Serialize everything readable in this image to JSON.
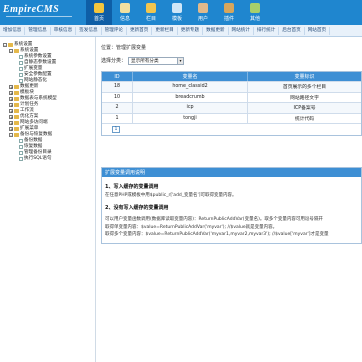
{
  "header": {
    "logo_text": "EmpireCMS",
    "tabs": [
      {
        "label": "首页",
        "icon": "home-icon",
        "color": "#f3c53d",
        "active": true
      },
      {
        "label": "信息",
        "icon": "info-icon",
        "color": "#f0e0a0",
        "active": false
      },
      {
        "label": "栏目",
        "icon": "column-icon",
        "color": "#f1c54f",
        "active": false
      },
      {
        "label": "模板",
        "icon": "template-icon",
        "color": "#cfe6f7",
        "active": false
      },
      {
        "label": "用户",
        "icon": "user-icon",
        "color": "#e0b98b",
        "active": false
      },
      {
        "label": "插件",
        "icon": "plugin-icon",
        "color": "#d7a65c",
        "active": false
      },
      {
        "label": "其他",
        "icon": "other-icon",
        "color": "#a7cf6b",
        "active": false
      }
    ]
  },
  "subbar": [
    "增加信息",
    "管理信息",
    "审核信息",
    "签发信息",
    "管理评论",
    "更新首页",
    "更新栏目",
    "更新专题",
    "数据更新",
    "网站统计",
    "排行统计",
    "后台首页",
    "网站首页"
  ],
  "sidebar": {
    "items": [
      {
        "label": "系统设置",
        "indent": 0,
        "box": "-",
        "type": "folder"
      },
      {
        "label": "系统设置",
        "indent": 1,
        "box": "-",
        "type": "folder"
      },
      {
        "label": "系统参数设置",
        "indent": 2,
        "box": "",
        "type": "doc"
      },
      {
        "label": "自静态参数设置",
        "indent": 2,
        "box": "",
        "type": "doc"
      },
      {
        "label": "扩展变量",
        "indent": 2,
        "box": "",
        "type": "doc"
      },
      {
        "label": "安全参数配置",
        "indent": 2,
        "box": "",
        "type": "doc"
      },
      {
        "label": "网站静态化",
        "indent": 2,
        "box": "",
        "type": "doc"
      },
      {
        "label": "数据更新",
        "indent": 1,
        "box": "+",
        "type": "folder"
      },
      {
        "label": "模板块",
        "indent": 1,
        "box": "+",
        "type": "folder"
      },
      {
        "label": "数据表与系统模型",
        "indent": 1,
        "box": "+",
        "type": "folder"
      },
      {
        "label": "计划任务",
        "indent": 1,
        "box": "+",
        "type": "folder"
      },
      {
        "label": "工作流",
        "indent": 1,
        "box": "+",
        "type": "folder"
      },
      {
        "label": "优化方案",
        "indent": 1,
        "box": "+",
        "type": "folder"
      },
      {
        "label": "网站多访问端",
        "indent": 1,
        "box": "+",
        "type": "folder"
      },
      {
        "label": "扩展菜单",
        "indent": 1,
        "box": "+",
        "type": "folder"
      },
      {
        "label": "备份与恢复数据",
        "indent": 1,
        "box": "-",
        "type": "folder"
      },
      {
        "label": "备份数据",
        "indent": 2,
        "box": "",
        "type": "doc"
      },
      {
        "label": "恢复数据",
        "indent": 2,
        "box": "",
        "type": "doc"
      },
      {
        "label": "管理备份目录",
        "indent": 2,
        "box": "",
        "type": "doc"
      },
      {
        "label": "执行SQL语句",
        "indent": 2,
        "box": "",
        "type": "doc"
      }
    ]
  },
  "main": {
    "breadcrumb": "位置：管理扩展变量",
    "select_label": "选择分类：",
    "select_value": "显示所有分类",
    "table": {
      "headers": {
        "id": "ID",
        "name": "变量名",
        "tag": "变量标识"
      },
      "rows": [
        {
          "id": "18",
          "name": "home_classid2",
          "tag": "首页展示的多个栏目"
        },
        {
          "id": "10",
          "name": "breadcrumb",
          "tag": "网站路径文字"
        },
        {
          "id": "2",
          "name": "icp",
          "tag": "ICP备案号"
        },
        {
          "id": "1",
          "name": "tongji",
          "tag": "统计代码"
        }
      ],
      "page": "1"
    },
    "help": {
      "title": "扩展变量调用说明",
      "s1_title": "1、写入缓存的变量调用",
      "s1_line": "在任意PHP或模板中用$public_r['add_变量名']可取得变量内容。",
      "s2_title": "2、没有写入缓存的变量调用",
      "s2_line1": "可以用户变量函数调用(数据库读取变量内容)：ReturnPublicAddVar(变量名)。取多个变量内容可用逗号隔开",
      "s2_line2": "取得单变量内容：$value=ReturnPublicAddVar('myvar'); //$value就是变量内容。",
      "s2_line3": "取得多个变量内容：$value=ReturnPublicAddVar('myvar1,myvar2,myvar3'); //$value['myvar']才是变量"
    }
  }
}
